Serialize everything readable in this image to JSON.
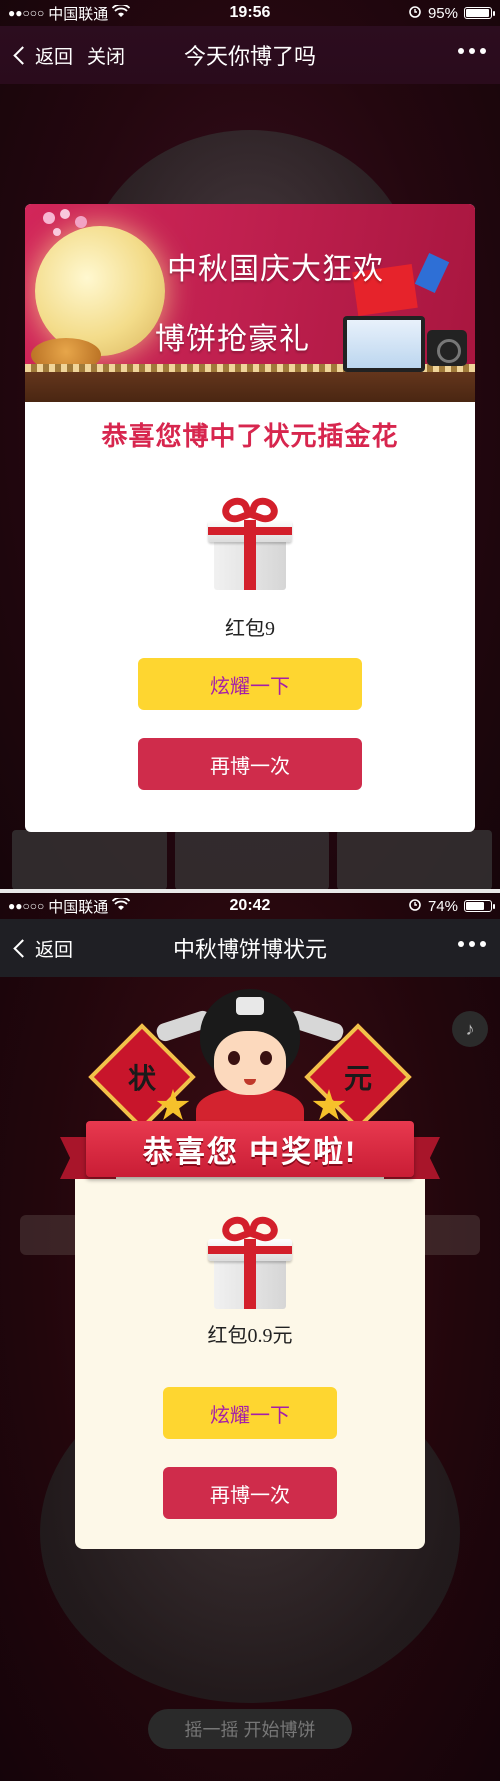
{
  "screen1": {
    "status": {
      "carrier": "中国联通",
      "time": "19:56",
      "battery": "95%",
      "battery_level": 0.95
    },
    "nav": {
      "back": "返回",
      "close": "关闭",
      "title": "今天你博了吗"
    },
    "banner": {
      "line1": "中秋国庆大狂欢",
      "line2": "博饼抢豪礼"
    },
    "congrats": "恭喜您博中了状元插金花",
    "prize": "红包9",
    "buttons": {
      "show_off": "炫耀一下",
      "again": "再博一次"
    }
  },
  "screen2": {
    "status": {
      "carrier": "中国联通",
      "time": "20:42",
      "battery": "74%",
      "battery_level": 0.74
    },
    "nav": {
      "back": "返回",
      "title": "中秋博饼博状元"
    },
    "ribbon": "恭喜您 中奖啦!",
    "badges": {
      "left": "状",
      "right": "元"
    },
    "prize": "红包0.9元",
    "buttons": {
      "show_off": "炫耀一下",
      "again": "再博一次"
    },
    "shake": "摇一摇 开始博饼"
  },
  "colors": {
    "congrats_red": "#d7264e",
    "button_yellow": "#fed630",
    "button_yellow_text": "#a51fa8",
    "button_red": "#cf2c4b"
  }
}
